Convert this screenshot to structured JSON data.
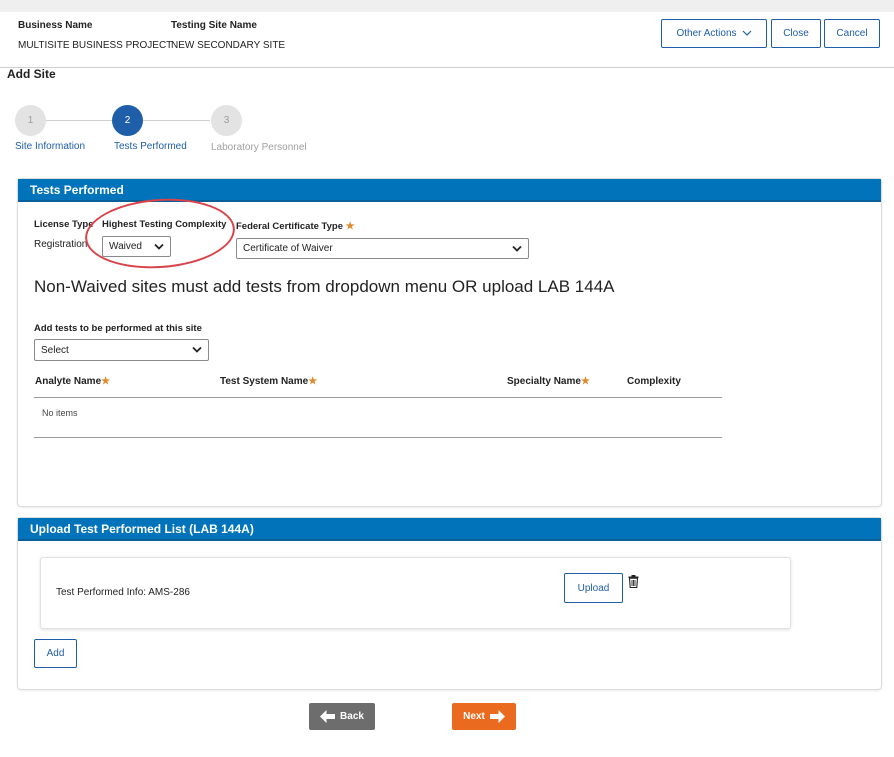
{
  "header": {
    "business_name_label": "Business Name",
    "business_name_value": "MULTISITE BUSINESS PROJECT",
    "testing_site_label": "Testing Site Name",
    "testing_site_value": "NEW SECONDARY SITE",
    "other_actions_label": "Other Actions",
    "close_label": "Close",
    "cancel_label": "Cancel"
  },
  "page_title": "Add Site",
  "stepper": {
    "steps": [
      {
        "number": "1",
        "label": "Site Information",
        "state": "complete"
      },
      {
        "number": "2",
        "label": "Tests Performed",
        "state": "active"
      },
      {
        "number": "3",
        "label": "Laboratory Personnel",
        "state": "inactive"
      }
    ]
  },
  "tests_panel": {
    "title": "Tests Performed",
    "license_type_label": "License Type",
    "license_type_value": "Registration",
    "complexity_label": "Highest Testing Complexity",
    "complexity_value": "Waived",
    "federal_cert_label": "Federal Certificate Type",
    "federal_cert_value": "Certificate of Waiver",
    "notice": "Non-Waived sites must add tests from dropdown menu OR upload LAB 144A",
    "add_tests_label": "Add tests to be performed at this site",
    "add_tests_value": "Select",
    "columns": {
      "analyte": "Analyte Name",
      "test_system": "Test System Name",
      "specialty": "Specialty Name",
      "complexity": "Complexity"
    },
    "empty_text": "No items"
  },
  "upload_panel": {
    "title": "Upload Test Performed List (LAB 144A)",
    "info_text": "Test Performed Info: AMS-286",
    "upload_label": "Upload",
    "add_label": "Add"
  },
  "footer": {
    "back_label": "Back",
    "next_label": "Next"
  },
  "colors": {
    "primary": "#0073bb",
    "step_active": "#1f5ea8",
    "next": "#ea6b1f",
    "back": "#6d6d6d",
    "required": "#e08a2b",
    "annotation": "#d8444a"
  },
  "icons": {
    "other_actions": "chevron-down-icon",
    "delete": "trash-icon",
    "back": "arrow-left-icon",
    "next": "arrow-right-icon"
  }
}
